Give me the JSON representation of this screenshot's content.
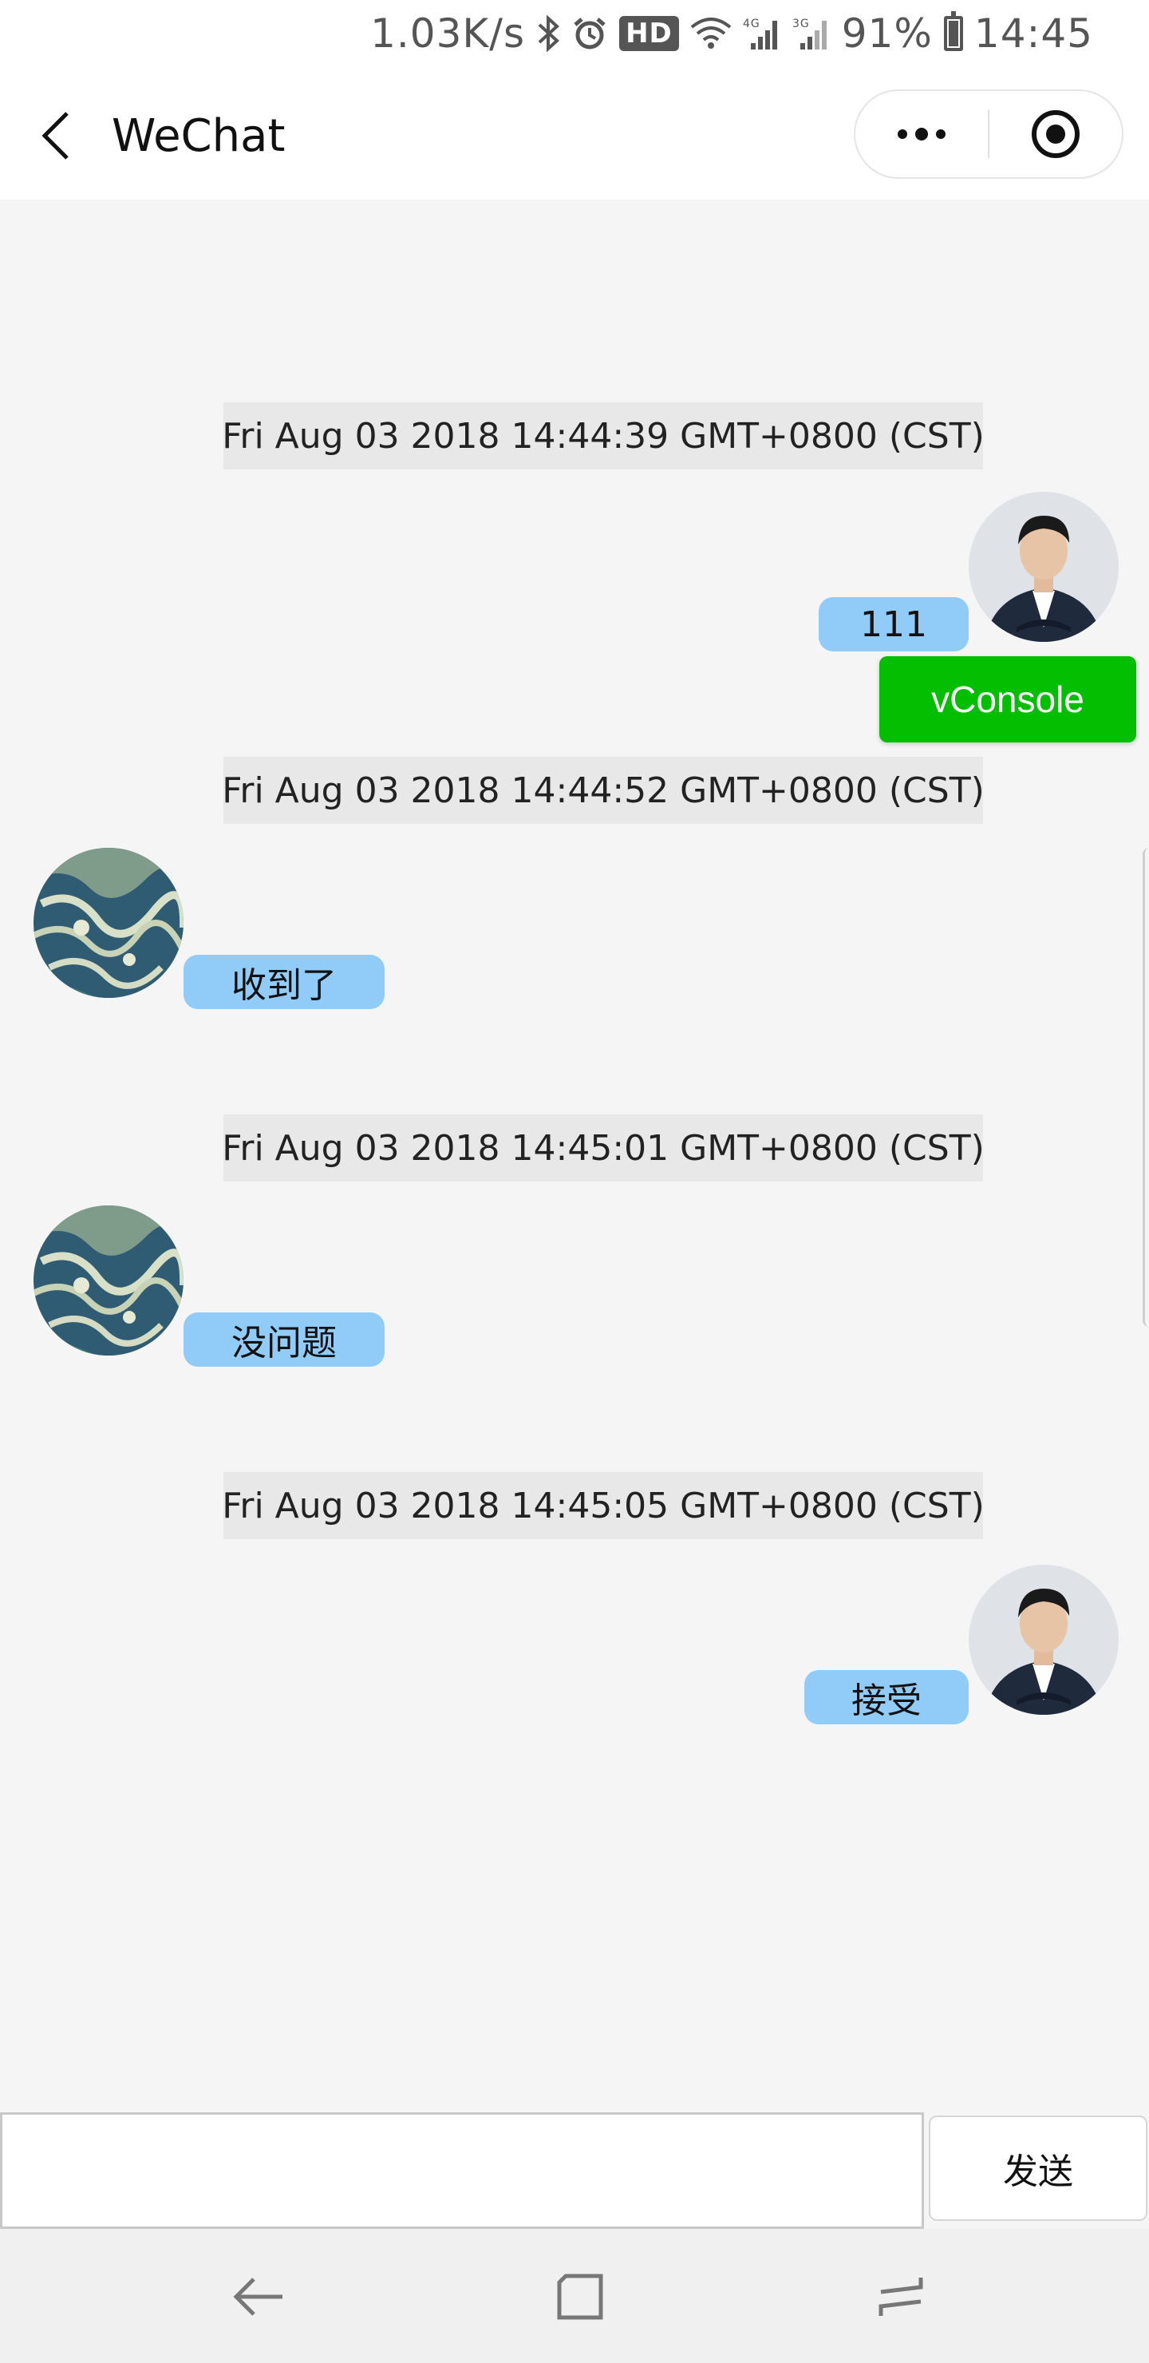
{
  "status_bar": {
    "speed": "1.03K/s",
    "hd_badge": "HD",
    "battery_percent": "91%",
    "time": "14:45"
  },
  "title_bar": {
    "title": "WeChat"
  },
  "messages": [
    {
      "timestamp": "Fri Aug 03 2018 14:44:39 GMT+0800 (CST)",
      "text": "111",
      "side": "right"
    },
    {
      "timestamp": "Fri Aug 03 2018 14:44:52 GMT+0800 (CST)",
      "text": "收到了",
      "side": "left"
    },
    {
      "timestamp": "Fri Aug 03 2018 14:45:01 GMT+0800 (CST)",
      "text": "没问题",
      "side": "left"
    },
    {
      "timestamp": "Fri Aug 03 2018 14:45:05 GMT+0800 (CST)",
      "text": "接受",
      "side": "right"
    }
  ],
  "vconsole_label": "vConsole",
  "input": {
    "value": "",
    "send_label": "发送"
  },
  "colors": {
    "bubble": "#91ccf8",
    "vconsole": "#04be02",
    "timestamp_bg": "#e8e8e8"
  }
}
